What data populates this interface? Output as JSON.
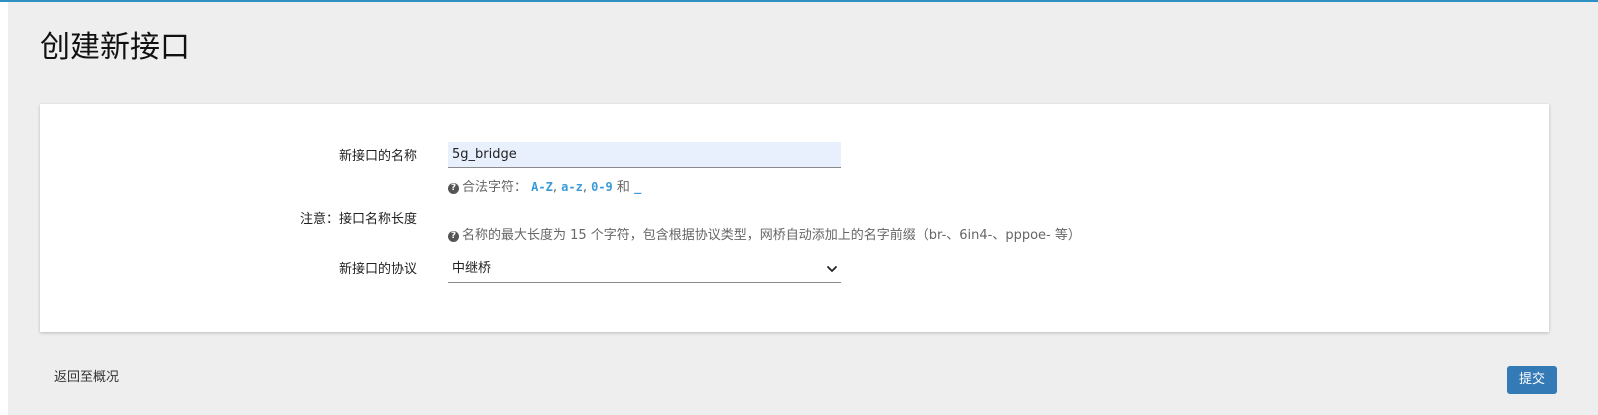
{
  "page": {
    "title": "创建新接口"
  },
  "form": {
    "name": {
      "label": "新接口的名称",
      "value": "5g_bridge",
      "hint_prefix": "合法字符：",
      "hint_az_upper": "A-Z",
      "hint_sep1": ",",
      "hint_az_lower": "a-z",
      "hint_sep2": ",",
      "hint_digits": "0-9",
      "hint_and": "和",
      "hint_underscore": "_"
    },
    "note": {
      "label": "注意：接口名称长度",
      "hint": "名称的最大长度为 15 个字符，包含根据协议类型，网桥自动添加上的名字前缀（br-、6in4-、pppoe- 等）"
    },
    "protocol": {
      "label": "新接口的协议",
      "selected": "中继桥"
    }
  },
  "actions": {
    "back_label": "返回至概况",
    "submit_label": "提交"
  },
  "colors": {
    "accent": "#337ab7",
    "top_line": "#2f8fc2",
    "code_text": "#3a9ad9",
    "input_autofill_bg": "#e8f0fe",
    "page_bg": "#eeeeee"
  },
  "icons": {
    "hint_icon": "question-circle-icon",
    "select_icon": "chevron-down-icon"
  }
}
